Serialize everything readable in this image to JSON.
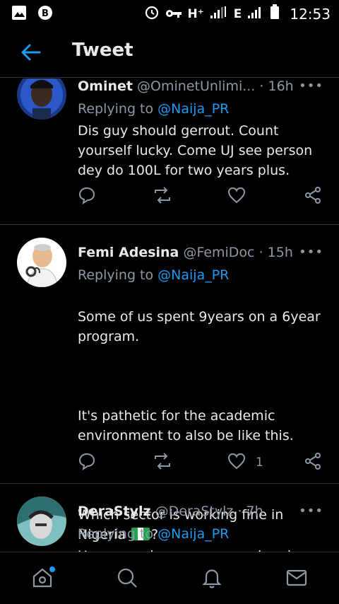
{
  "status_bar": {
    "network_label": "H⁺",
    "network2_label": "E",
    "time": "12:53"
  },
  "header": {
    "title": "Tweet"
  },
  "tweets": [
    {
      "name": "Ominet",
      "handle": "@OminetUnlimi...",
      "time": "· 16h",
      "replying_prefix": "Replying to",
      "replying_to": "@Naija_PR",
      "body": "Dis guy should gerrout. Count yourself lucky. Come UJ see person dey do 100L for two years plus.",
      "like_count": ""
    },
    {
      "name": "Femi Adesina",
      "handle": "@FemiDoc",
      "time": "· 15h",
      "replying_prefix": "Replying to",
      "replying_to": "@Naija_PR",
      "body_p1": "Some of us spent 9years on a 6year program.",
      "body_p2": "It's pathetic for the academic environment to also be like this.",
      "body_p3": "Which sector is working fine in Nigeria",
      "body_p3_end": "?",
      "like_count": "1"
    },
    {
      "name": "DeraStylz",
      "handle": "@DeraStylz",
      "time": "· 7h",
      "replying_prefix": "Replying to",
      "replying_to": "@Naija_PR",
      "body": "U no even happy me wey don dey"
    }
  ],
  "more_label": "•••",
  "colors": {
    "background": "#000000",
    "accent": "#1d9bf0",
    "muted": "#8b98a5",
    "divider": "#2f3336"
  },
  "icons": [
    "back-arrow-icon",
    "reply-icon",
    "retweet-icon",
    "like-icon",
    "share-icon",
    "home-icon",
    "search-icon",
    "notifications-icon",
    "messages-icon"
  ]
}
